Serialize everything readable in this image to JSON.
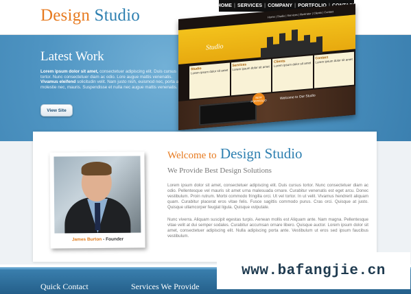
{
  "logo": {
    "word1": "Design",
    "word2": "Studio"
  },
  "nav": [
    "HOME",
    "SERVICES",
    "COMPANY",
    "PORTFOLIO",
    "CONTACT"
  ],
  "hero": {
    "title": "Latest Work",
    "text_bold1": "Lorem ipsum dolor sit amet,",
    "text1": " consectetuer adipiscing elit. Duis cursus tortor. Nunc consectetuer diam ac odio. Lore augue mattis venenatis. ",
    "text_bold2": "Vivamus eleifend",
    "text2": " solicitudin velit. Nam justo nish, euismod nec, porta at, molestie nec, mauris. Suspendisse et nulla nec augue mattis venenatis.",
    "button": "View Site"
  },
  "preview": {
    "nav": "Home | Studio | Services | Illustrator | Clients | Contact",
    "logo": "Studio",
    "cols": [
      "Studio",
      "Services",
      "Clients",
      "Contact"
    ],
    "welcome": "Welcome to Our Studio",
    "badge": "NEW PORTFOLIO"
  },
  "welcome": {
    "prefix": "Welcome to",
    "name": "Design Studio",
    "subhead": "We Provide Best Design Solutions"
  },
  "body1": "Lorem ipsum dolor sit amet, consectetuer adipiscing elit. Duis cursus tortor. Nunc consectetuer diam ac odio. Pellentesque vel mauris sit amet urna malesuada ornare. Curabitur venenatis est eget arcu. Donec vestibulum. Proin rutrum. Morbi commodo fringilla orci. Ut vel tortor. In ut velit. Vivamus hendrerit aliquam quam. Curabitur placerat eros vitae felis. Fusce sagittis commodo purus. Cras orci. Quisque at justo. Quisque ullamcorper feugiat ligula. Quisque vulputate.",
  "body2": "Nunc viverra. Aliquam suscipit egestas turpis. Aenean mollis est Aliquam ante. Nam magna. Pellentesque vitae velit at dui semper sodales. Curabitur accumsan ornare libero. Quisque auctor. Lorem ipsum dolor sit amet, consectetuer adipiscing elit. Nulla adipiscing porta ante. Vestibulum ut eros sed ipsum faucibus vestibulum.",
  "founder": {
    "name": "James Burton",
    "role": " - Founder"
  },
  "footer": {
    "col1": "Quick Contact",
    "col2": "Services We Provide"
  },
  "watermark": "www.bafangjie.cn"
}
